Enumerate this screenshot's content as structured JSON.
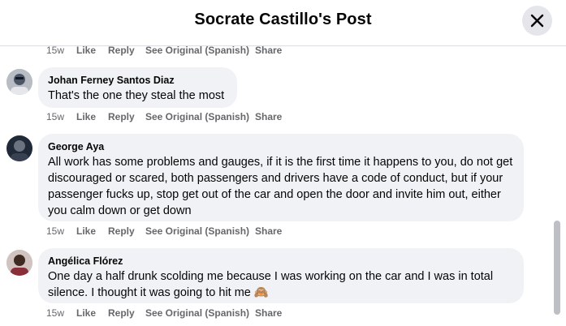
{
  "header": {
    "title": "Socrate Castillo's Post"
  },
  "actions": {
    "like": "Like",
    "reply": "Reply",
    "see_original": "See Original (Spanish)",
    "share": "Share"
  },
  "comments": [
    {
      "author": "",
      "text": "",
      "time": "15w"
    },
    {
      "author": "Johan Ferney Santos Diaz",
      "text": "That's the one they steal the most",
      "time": "15w"
    },
    {
      "author": "George Aya",
      "text": "All work has some problems and gauges, if it is the first time it happens to you, do not get discouraged or scared, both passengers and drivers have a code of conduct, but if your passenger fucks up, stop get out of the car and open the door and invite him out, either you calm down or get down",
      "time": "15w"
    },
    {
      "author": "Angélica Flórez",
      "text": "One day a half drunk scolding me because I was working on the car and I was in total silence. I thought it was going to hit me 🙈",
      "time": "15w"
    }
  ],
  "icons": {
    "close": "close-icon",
    "emoji": "see-no-evil-monkey-emoji"
  },
  "colors": {
    "bubble": "#f0f2f5",
    "meta": "#65676b",
    "close_bg": "#e4e6eb"
  }
}
